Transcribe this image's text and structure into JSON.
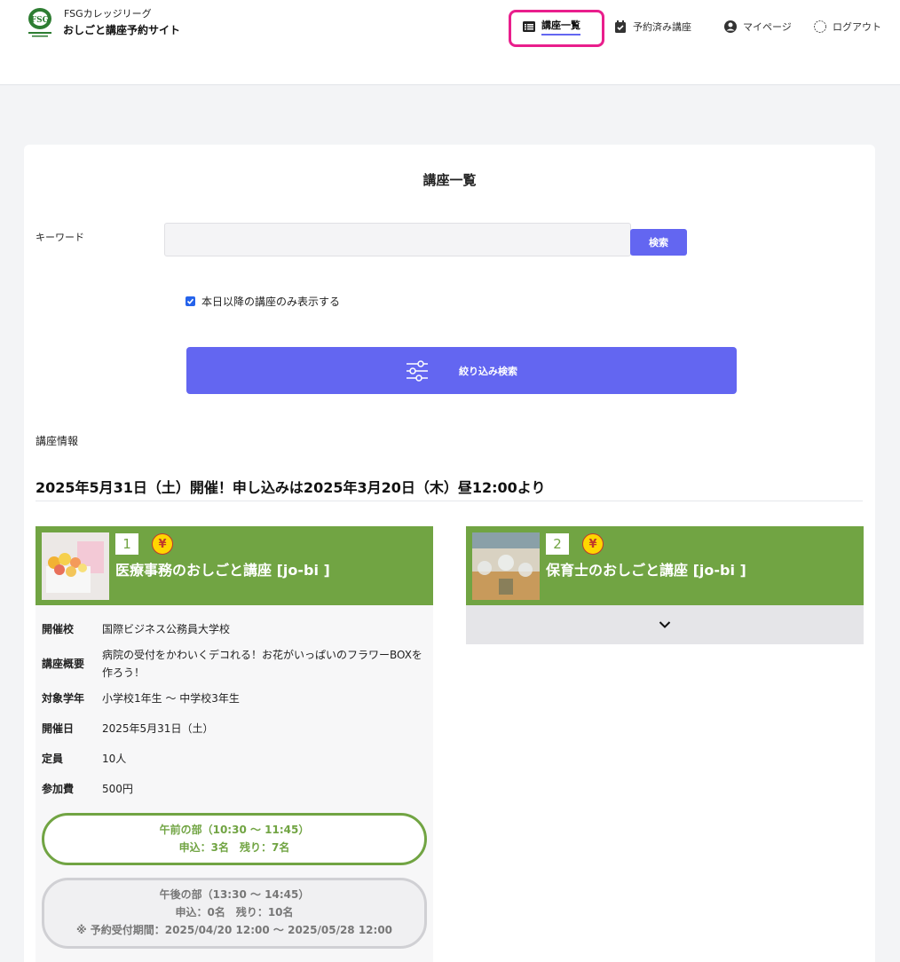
{
  "header": {
    "brand_top": "FSGカレッジリーグ",
    "brand_main": "おしごと講座予約サイト",
    "nav": {
      "courses": "講座一覧",
      "reserved": "予約済み講座",
      "mypage": "マイページ",
      "logout": "ログアウト"
    },
    "accent_color": "#6366f1",
    "highlight_color": "#e91e8c"
  },
  "main": {
    "title": "講座一覧",
    "keyword_label": "キーワード",
    "keyword_value": "",
    "search_button": "検索",
    "only_future_label": "本日以降の講座のみ表示する",
    "only_future_checked": true,
    "filter_button": "絞り込み検索",
    "section_label": "講座情報",
    "event_title": "2025年5月31日（土）開催！申し込みは2025年3月20日（木）昼12:00より"
  },
  "courses": [
    {
      "number": "1",
      "fee_icon": "¥",
      "name": "医療事務のおしごと講座 [jo-bi ]",
      "expanded": true,
      "details": {
        "school_label": "開催校",
        "school": "国際ビジネス公務員大学校",
        "summary_label": "講座概要",
        "summary": "病院の受付をかわいくデコれる！お花がいっぱいのフラワーBOXを作ろう！",
        "grade_label": "対象学年",
        "grade": "小学校1年生 〜 中学校3年生",
        "date_label": "開催日",
        "date": "2025年5月31日（土）",
        "capacity_label": "定員",
        "capacity": "10人",
        "fee_label": "参加費",
        "fee": "500円"
      },
      "sessions": [
        {
          "title": "午前の部（10:30 〜 11:45）",
          "status": "申込：3名　残り：7名",
          "note": ""
        },
        {
          "title": "午後の部（13:30 〜 14:45）",
          "status": "申込：0名　残り：10名",
          "note": "※ 予約受付期間：2025/04/20 12:00 〜 2025/05/28 12:00"
        }
      ]
    },
    {
      "number": "2",
      "fee_icon": "¥",
      "name": "保育士のおしごと講座 [jo-bi ]",
      "expanded": false
    }
  ],
  "colors": {
    "course_green": "#71a443",
    "yen_yellow": "#ffd600"
  }
}
